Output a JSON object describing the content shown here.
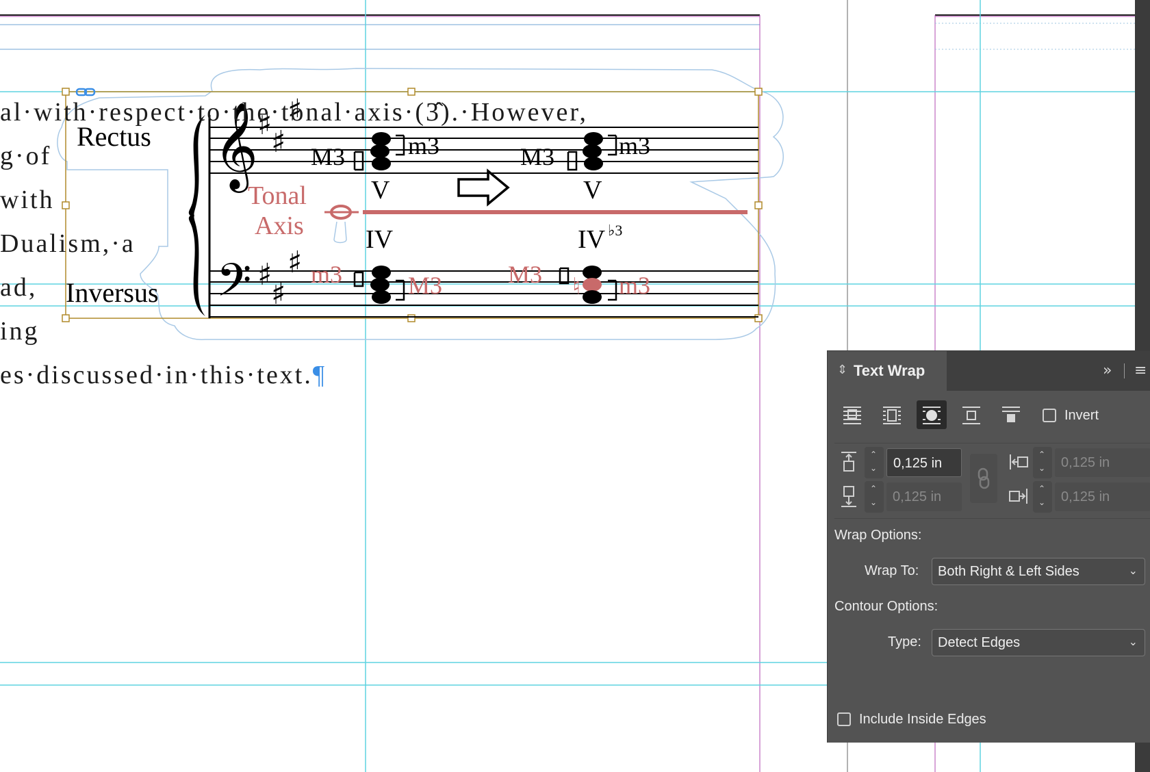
{
  "document": {
    "text_lines": [
      "al·with·respect·to·the·tonal·axis·(3̂).·However,",
      "g·of",
      "with",
      "Dualism,·a",
      "ad,",
      "ing",
      "es·discussed·in·this·text."
    ],
    "pilcrow": "¶",
    "figure": {
      "rectus_label": "Rectus",
      "inversus_label": "Inversus",
      "tonal_axis_label_1": "Tonal",
      "tonal_axis_label_2": "Axis",
      "interval_labels": {
        "treble_1_lower": "M3",
        "treble_1_upper": "m3",
        "treble_2_lower": "M3",
        "treble_2_upper": "m3",
        "bass_1_upper": "m3",
        "bass_1_lower": "M3",
        "bass_2_upper": "M3",
        "bass_2_lower": "m3"
      },
      "roman_numerals": {
        "upper_1": "V",
        "upper_2": "V",
        "lower_1": "IV",
        "lower_2": "IV",
        "lower_2_sup": "♭3"
      },
      "accent_color": "#c86a6a"
    }
  },
  "text_wrap_panel": {
    "title": "Text Wrap",
    "wrap_buttons": [
      {
        "name": "no-text-wrap",
        "active": false
      },
      {
        "name": "wrap-around-bounding-box",
        "active": false
      },
      {
        "name": "wrap-around-object-shape",
        "active": true
      },
      {
        "name": "jump-object",
        "active": false
      },
      {
        "name": "jump-to-next-column",
        "active": false
      }
    ],
    "invert_label": "Invert",
    "invert_checked": false,
    "offsets": {
      "top": "0,125 in",
      "bottom": "0,125 in",
      "left": "0,125 in",
      "right": "0,125 in"
    },
    "wrap_options_label": "Wrap Options:",
    "wrap_to_label": "Wrap To:",
    "wrap_to_value": "Both Right & Left Sides",
    "contour_options_label": "Contour Options:",
    "type_label": "Type:",
    "type_value": "Detect Edges",
    "include_inside_edges_label": "Include Inside Edges",
    "include_inside_edges_checked": false
  }
}
